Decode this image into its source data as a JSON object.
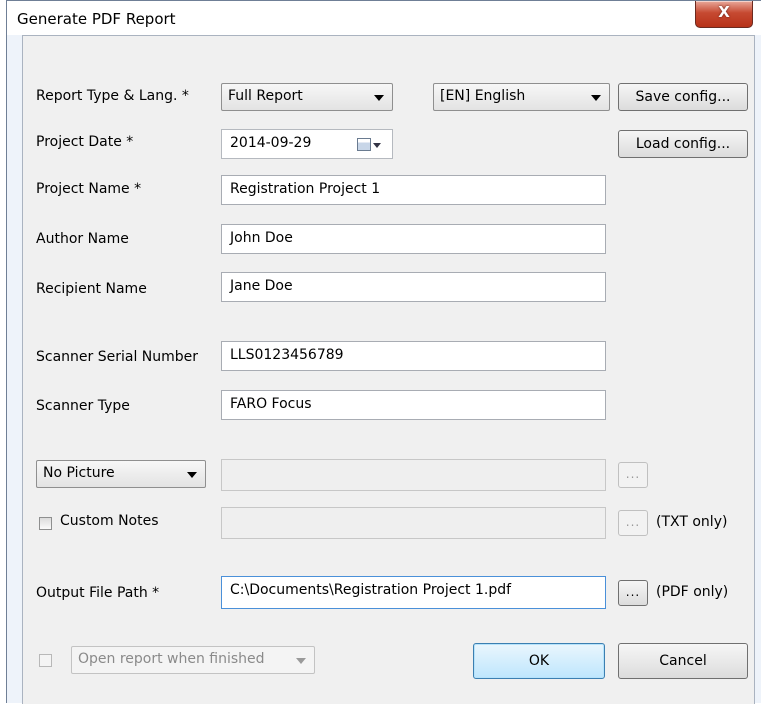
{
  "window": {
    "title": "Generate PDF Report",
    "close_label": "X"
  },
  "form": {
    "report_type_label": "Report Type & Lang. *",
    "report_type_value": "Full Report",
    "language_value": "[EN] English",
    "save_config_label": "Save config...",
    "project_date_label": "Project Date *",
    "project_date_value": "2014-09-29",
    "load_config_label": "Load config...",
    "project_name_label": "Project Name *",
    "project_name_value": "Registration Project 1",
    "author_name_label": "Author Name",
    "author_name_value": "John Doe",
    "recipient_name_label": "Recipient Name",
    "recipient_name_value": "Jane Doe",
    "scanner_serial_label": "Scanner Serial Number",
    "scanner_serial_value": "LLS0123456789",
    "scanner_type_label": "Scanner Type",
    "scanner_type_value": "FARO Focus",
    "picture_mode_value": "No Picture",
    "picture_path_value": "",
    "browse_label": "...",
    "custom_notes_label": "Custom Notes",
    "custom_notes_value": "",
    "txt_only_label": "(TXT only)",
    "output_path_label": "Output File Path *",
    "output_path_value": "C:\\Documents\\Registration Project 1.pdf",
    "pdf_only_label": "(PDF only)",
    "open_report_value": "Open report when finished"
  },
  "buttons": {
    "ok_label": "OK",
    "cancel_label": "Cancel"
  },
  "icons": {
    "calendar": "calendar-icon",
    "dropdown": "chevron-down-icon"
  },
  "colors": {
    "window_frame": "#eef3fa",
    "client_bg": "#f0f0f0",
    "close_button": "#c64a32",
    "default_button": "#bee6fd"
  }
}
